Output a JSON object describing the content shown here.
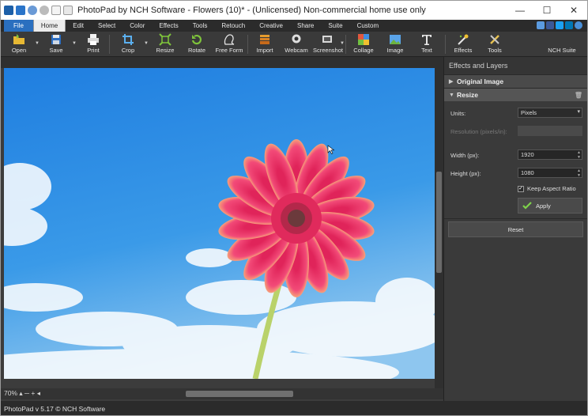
{
  "window": {
    "title": "PhotoPad by NCH Software - Flowers (10)* - (Unlicensed) Non-commercial home use only",
    "controls": [
      "—",
      "☐",
      "✕"
    ]
  },
  "menu_tabs": [
    "File",
    "Home",
    "Edit",
    "Select",
    "Color",
    "Effects",
    "Tools",
    "Retouch",
    "Creative",
    "Share",
    "Suite",
    "Custom"
  ],
  "active_tab": "Home",
  "toolbar": {
    "open": "Open",
    "save": "Save",
    "print": "Print",
    "crop": "Crop",
    "resize": "Resize",
    "rotate": "Rotate",
    "free_form": "Free Form",
    "import": "Import",
    "webcam": "Webcam",
    "screenshot": "Screenshot",
    "collage": "Collage",
    "image": "Image",
    "text": "Text",
    "effects": "Effects",
    "tools": "Tools",
    "nch_suite": "NCH Suite"
  },
  "panel": {
    "title": "Effects and Layers",
    "original_image": "Original Image",
    "resize": "Resize",
    "units_label": "Units:",
    "units_value": "Pixels",
    "resolution_label": "Resolution (pixels/in):",
    "width_label": "Width (px):",
    "width_value": "1920",
    "height_label": "Height (px):",
    "height_value": "1080",
    "keep_aspect": "Keep Aspect Ratio",
    "keep_aspect_checked": true,
    "apply": "Apply",
    "reset": "Reset"
  },
  "zoom": "70%",
  "status": "PhotoPad v 5.17 © NCH Software",
  "colors": {
    "sky": "#2f8de4",
    "petal": "#f0386a",
    "stem": "#b9d26a",
    "accent": "#2a6fbf"
  }
}
